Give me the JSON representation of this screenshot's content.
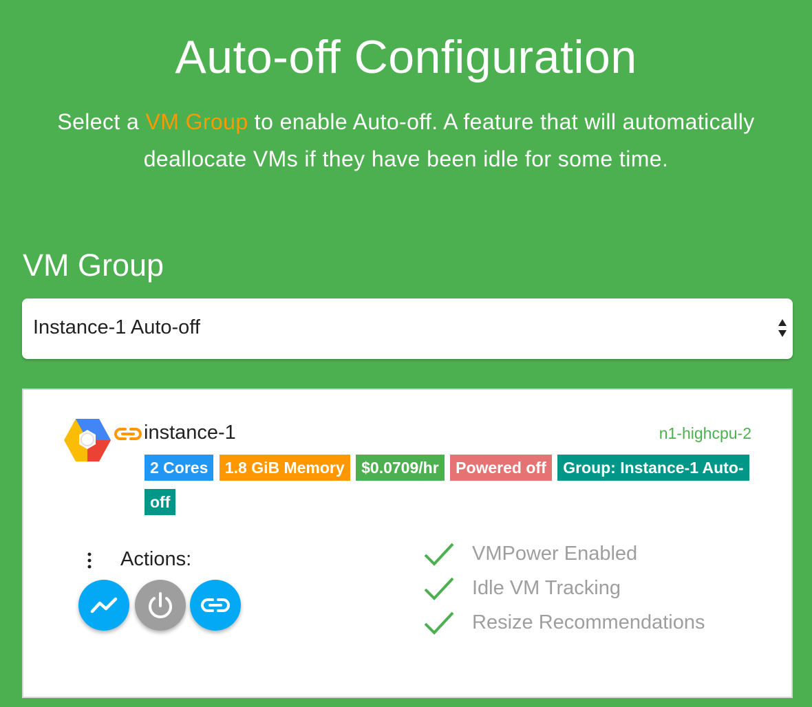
{
  "header": {
    "title": "Auto-off Configuration",
    "subtitle_before": "Select a ",
    "subtitle_highlight": "VM Group",
    "subtitle_after": " to enable Auto-off. A feature that will automatically deallocate VMs if they have been idle for some time."
  },
  "vm_group": {
    "label": "VM Group",
    "selected": "Instance-1 Auto-off"
  },
  "vm_card": {
    "name": "instance-1",
    "machine_type": "n1-highcpu-2",
    "badges": {
      "cores": "2 Cores",
      "memory": "1.8 GiB Memory",
      "price": "$0.0709/hr",
      "state": "Powered off",
      "group": "Group: Instance-1 Auto-off"
    },
    "actions_label": "Actions:",
    "action_icons": [
      "trending-icon",
      "power-icon",
      "link-icon"
    ],
    "features": [
      "VMPower Enabled",
      "Idle VM Tracking",
      "Resize Recommendations"
    ]
  },
  "colors": {
    "background": "#4caf50",
    "highlight": "#ff9800",
    "badge_blue": "#2196f3",
    "badge_orange": "#ff9800",
    "badge_green": "#4caf50",
    "badge_red": "#e57373",
    "badge_teal": "#009688",
    "fab_blue": "#03a9f4",
    "fab_grey": "#9e9e9e"
  }
}
